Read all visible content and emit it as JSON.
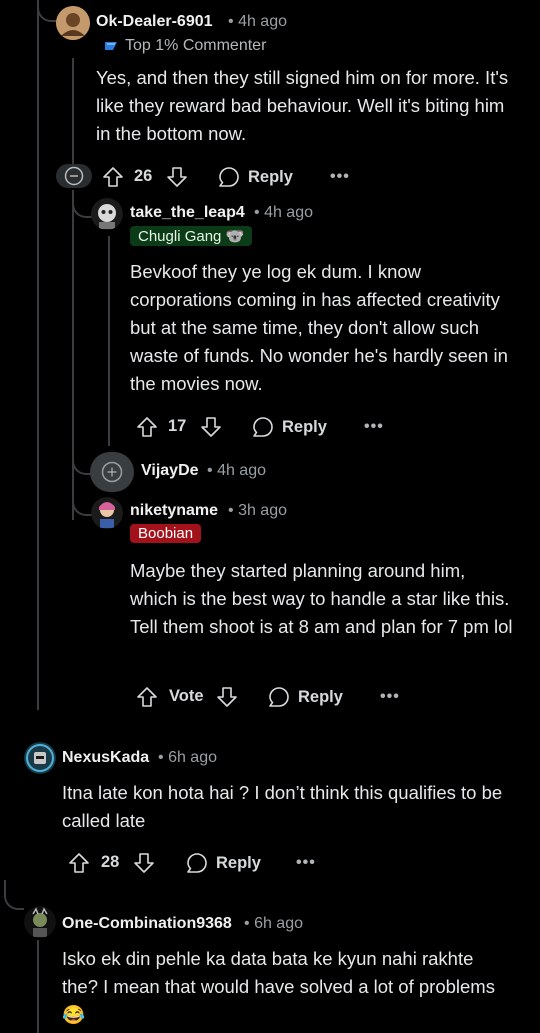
{
  "comments": [
    {
      "username": "Ok-Dealer-6901",
      "time": "4h ago",
      "flair": "Top 1% Commenter",
      "flair_icon": "achievement-icon",
      "body": "Yes, and then they still signed him on for more. It's like they reward bad behaviour. Well it's biting him in the bottom now.",
      "votes": "26",
      "reply_label": "Reply"
    },
    {
      "username": "take_the_leap4",
      "time": "4h ago",
      "flair": "Chugli Gang 🐨",
      "flair_color": "#0c3b17",
      "flair_text_color": "#e8f5e9",
      "body": "Bevkoof they ye log ek dum. I know corporations coming in has affected creativity but at the same time, they don't allow such waste of funds. No wonder he's hardly seen in the movies now.",
      "votes": "17",
      "reply_label": "Reply"
    },
    {
      "username": "VijayDe",
      "time": "4h ago",
      "collapsed": true
    },
    {
      "username": "niketyname",
      "time": "3h ago",
      "flair": "Boobian",
      "flair_color": "#a3121a",
      "flair_text_color": "#ffffff",
      "body": "Maybe they started planning around him, which is the best way to handle a star like this. Tell them shoot is at 8 am and plan for 7 pm lol",
      "votes": "Vote",
      "reply_label": "Reply"
    },
    {
      "username": "NexusKada",
      "time": "6h ago",
      "body": "Itna late kon hota hai ? I don’t think this qualifies to be called late",
      "votes": "28",
      "reply_label": "Reply"
    },
    {
      "username": "One-Combination9368",
      "time": "6h ago",
      "body": "Isko ek din pehle ka data bata ke kyun nahi rakhte the? I mean that would have solved a lot of problems 😂"
    }
  ],
  "separator": "•",
  "more_label": "•••",
  "colors": {
    "background": "#000000",
    "thread_line": "#3a3d3f",
    "meta_text": "#9a9fa3"
  }
}
